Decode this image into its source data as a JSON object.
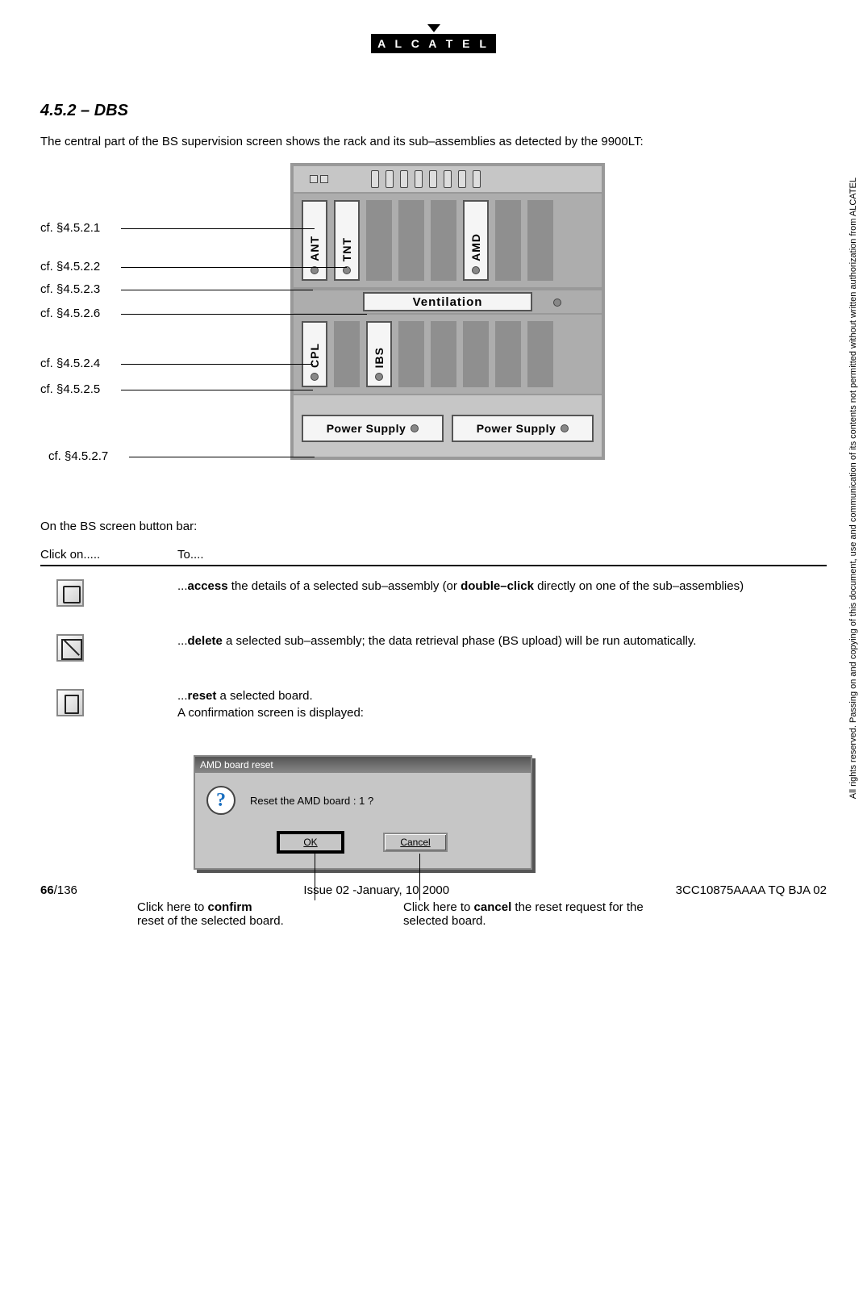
{
  "logo": {
    "text": "A L C A T E L"
  },
  "section": {
    "number": "4.5.2",
    "title_sep": " – ",
    "title": "DBS"
  },
  "intro": "The central part of the BS supervision screen shows the rack and its sub–assemblies as detected by the 9900LT:",
  "rack": {
    "row1_cards": [
      "ANT",
      "TNT",
      "AMD"
    ],
    "ventilation": "Ventilation",
    "row2_cards": [
      "CPL",
      "IBS"
    ],
    "psu": "Power Supply"
  },
  "callouts": {
    "c1": "cf. §4.5.2.1",
    "c2": "cf. §4.5.2.2",
    "c3": "cf. §4.5.2.3",
    "c6": "cf. §4.5.2.6",
    "c4": "cf. §4.5.2.4",
    "c5": "cf. §4.5.2.5",
    "c7": "cf. §4.5.2.7"
  },
  "button_bar": {
    "intro": "On the BS screen button bar:",
    "header": {
      "col1": "Click on.....",
      "col2": "To...."
    },
    "rows": {
      "access": {
        "pre": "...",
        "b1": "access",
        "mid": " the details of a selected sub–assembly (or ",
        "b2": "double–click",
        "suf": " directly on one of the sub–assemblies)"
      },
      "delete": {
        "pre": "...",
        "b1": "delete",
        "suf": " a selected sub–assembly; the data retrieval phase (BS upload) will be run automatically."
      },
      "reset": {
        "pre": "...",
        "b1": "reset",
        "suf": " a selected board.",
        "line2": "A confirmation screen is displayed:"
      }
    }
  },
  "dialog": {
    "title": "AMD board reset",
    "message": "Reset the AMD board : 1 ?",
    "ok": "OK",
    "cancel": "Cancel"
  },
  "dlg_notes": {
    "confirm1": "Click here to ",
    "confirm_b": "confirm",
    "confirm2": "reset of the selected board.",
    "cancel1": "Click here to ",
    "cancel_b": "cancel",
    "cancel2": " the reset request for the selected board."
  },
  "side_note": "All rights reserved. Passing on and copying of this document, use and communication of its contents not permitted without written authorization from ALCATEL",
  "footer": {
    "page_b": "66",
    "page_suf": "/136",
    "issue": "Issue 02 -January, 10 2000",
    "docref": "3CC10875AAAA TQ BJA 02"
  }
}
